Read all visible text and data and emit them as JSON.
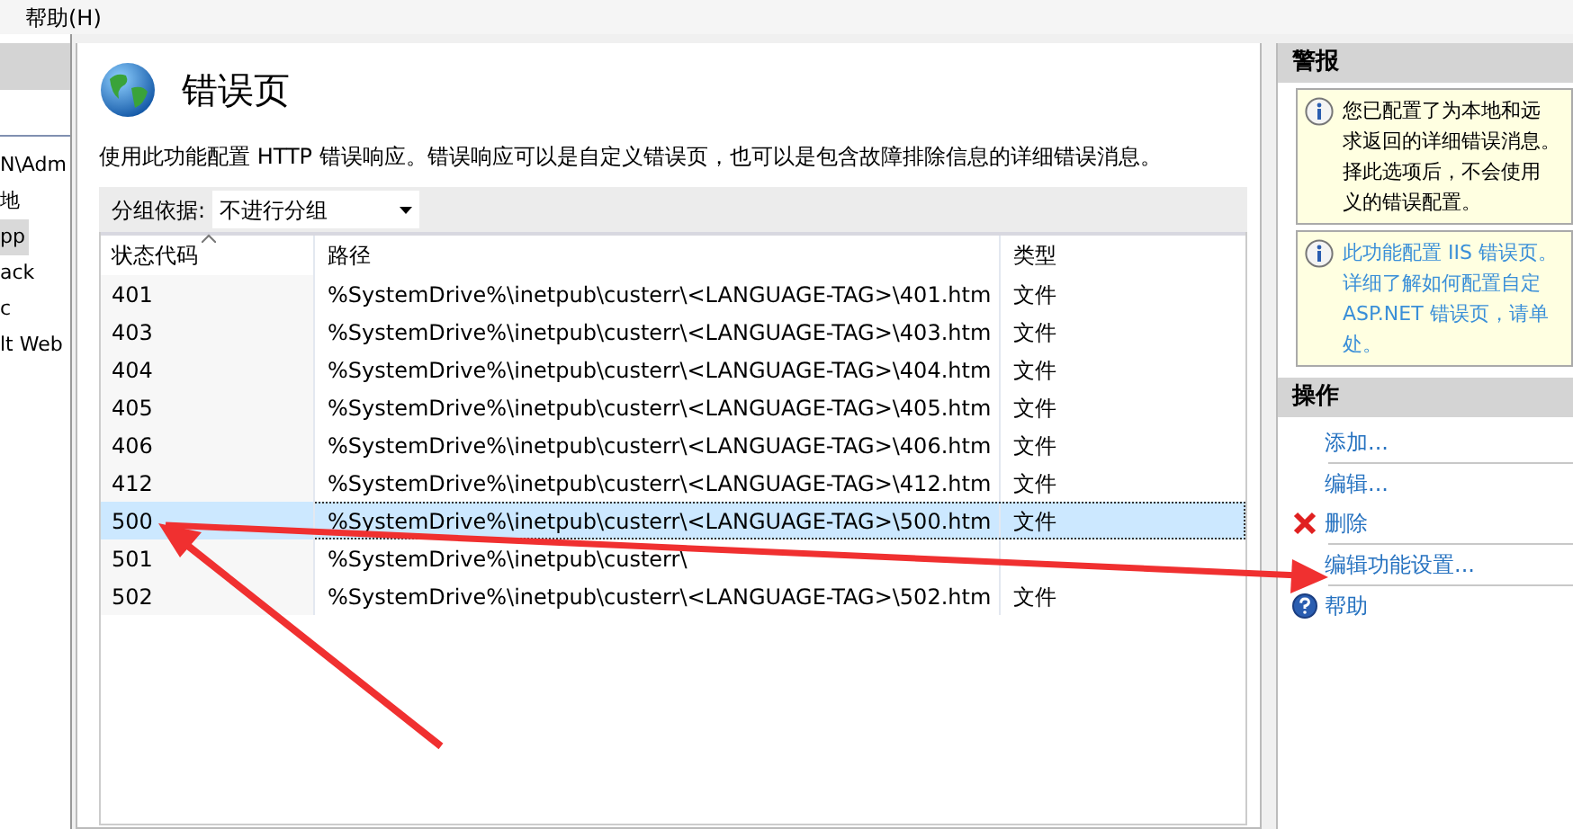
{
  "menu_bar": {
    "items": [
      "帮助(H)"
    ]
  },
  "tree": {
    "items": [
      {
        "text": "N\\Adm",
        "selected": false
      },
      {
        "text": "地",
        "selected": false
      },
      {
        "text": "pp",
        "selected": true
      },
      {
        "text": "ack",
        "selected": false
      },
      {
        "text": "c",
        "selected": false
      },
      {
        "text": "lt Web",
        "selected": false
      }
    ]
  },
  "page": {
    "title": "错误页",
    "description": "使用此功能配置 HTTP 错误响应。错误响应可以是自定义错误页，也可以是包含故障排除信息的详细错误消息。",
    "group_by": {
      "label": "分组依据:",
      "value": "不进行分组"
    },
    "table": {
      "columns": [
        "状态代码",
        "路径",
        "类型"
      ],
      "rows": [
        {
          "code": "401",
          "path": "%SystemDrive%\\inetpub\\custerr\\<LANGUAGE-TAG>\\401.htm",
          "type": "文件",
          "selected": false
        },
        {
          "code": "403",
          "path": "%SystemDrive%\\inetpub\\custerr\\<LANGUAGE-TAG>\\403.htm",
          "type": "文件",
          "selected": false
        },
        {
          "code": "404",
          "path": "%SystemDrive%\\inetpub\\custerr\\<LANGUAGE-TAG>\\404.htm",
          "type": "文件",
          "selected": false
        },
        {
          "code": "405",
          "path": "%SystemDrive%\\inetpub\\custerr\\<LANGUAGE-TAG>\\405.htm",
          "type": "文件",
          "selected": false
        },
        {
          "code": "406",
          "path": "%SystemDrive%\\inetpub\\custerr\\<LANGUAGE-TAG>\\406.htm",
          "type": "文件",
          "selected": false
        },
        {
          "code": "412",
          "path": "%SystemDrive%\\inetpub\\custerr\\<LANGUAGE-TAG>\\412.htm",
          "type": "文件",
          "selected": false
        },
        {
          "code": "500",
          "path": "%SystemDrive%\\inetpub\\custerr\\<LANGUAGE-TAG>\\500.htm",
          "type": "文件",
          "selected": true
        },
        {
          "code": "501",
          "path": "%SystemDrive%\\inetpub\\custerr\\",
          "selected": false
        },
        {
          "code": "502",
          "path": "%SystemDrive%\\inetpub\\custerr\\<LANGUAGE-TAG>\\502.htm",
          "type": "文件",
          "selected": false
        }
      ]
    }
  },
  "alerts": {
    "title": "警报",
    "items": [
      {
        "kind": "text",
        "lines": [
          "您已配置了为本地和远",
          "求返回的详细错误消息。",
          "择此选项后，不会使用",
          "义的错误配置。"
        ]
      },
      {
        "kind": "link",
        "lines": [
          "此功能配置 IIS 错误页。",
          "详细了解如何配置自定",
          "ASP.NET 错误页，请单",
          "处。"
        ]
      }
    ]
  },
  "actions": {
    "title": "操作",
    "groups": [
      [
        {
          "label": "添加...",
          "kind": "plain"
        }
      ],
      [
        {
          "label": "编辑...",
          "kind": "plain"
        },
        {
          "label": "删除",
          "kind": "delete"
        }
      ],
      [
        {
          "label": "编辑功能设置...",
          "kind": "plain"
        }
      ],
      [
        {
          "label": "帮助",
          "kind": "help"
        }
      ]
    ]
  }
}
